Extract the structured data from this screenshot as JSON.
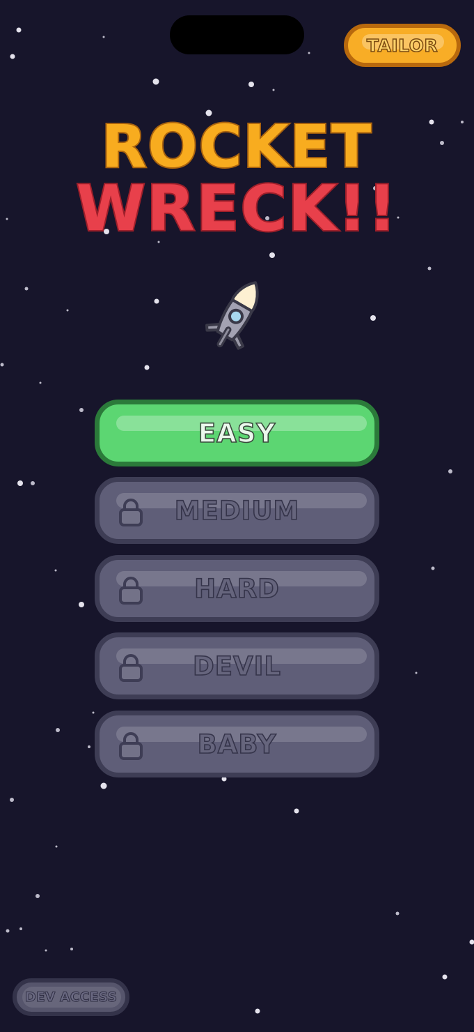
{
  "header": {
    "tailor_label": "TAILOR"
  },
  "title": {
    "line1": "ROCKET",
    "line2": "WRECK!!"
  },
  "levels": [
    {
      "label": "EASY",
      "locked": false
    },
    {
      "label": "MEDIUM",
      "locked": true
    },
    {
      "label": "HARD",
      "locked": true
    },
    {
      "label": "DEVIL",
      "locked": true
    },
    {
      "label": "BABY",
      "locked": true
    }
  ],
  "footer": {
    "dev_access_label": "DEV ACCESS"
  },
  "colors": {
    "background": "#17152b",
    "title_orange": "#f8ac1f",
    "title_red": "#e8404b",
    "unlocked_green": "#5cd672",
    "locked_gray": "#5f5e78",
    "tailor_orange": "#f8ad26"
  },
  "icons": {
    "rocket": "rocket-icon",
    "lock": "lock-icon"
  }
}
